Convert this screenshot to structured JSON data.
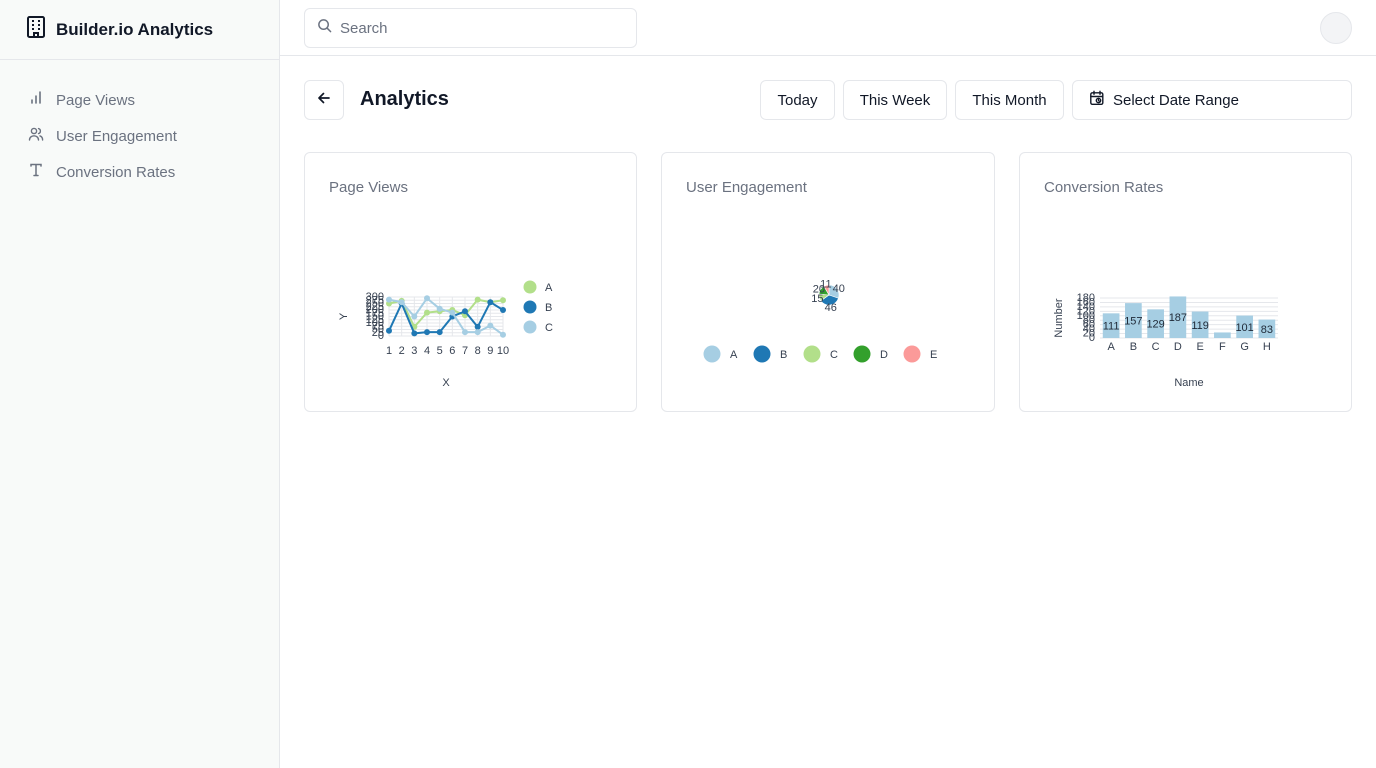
{
  "app": {
    "title": "Builder.io Analytics"
  },
  "sidebar": {
    "items": [
      {
        "label": "Page Views",
        "icon": "bar-chart-icon"
      },
      {
        "label": "User Engagement",
        "icon": "users-icon"
      },
      {
        "label": "Conversion Rates",
        "icon": "type-icon"
      }
    ]
  },
  "search": {
    "placeholder": "Search",
    "value": ""
  },
  "header": {
    "title": "Analytics",
    "buttons": {
      "today": "Today",
      "week": "This Week",
      "month": "This Month",
      "range": "Select Date Range"
    }
  },
  "cards": {
    "page_views": {
      "title": "Page Views"
    },
    "engagement": {
      "title": "User Engagement"
    },
    "conversion": {
      "title": "Conversion Rates"
    }
  },
  "colors": {
    "a_light_blue": "#a6cee3",
    "b_blue": "#1f78b4",
    "c_light_green": "#b2df8a",
    "d_green": "#33a02c",
    "e_pink": "#fb9a99"
  },
  "chart_data": [
    {
      "type": "line",
      "title": "",
      "xlabel": "X",
      "ylabel": "Y",
      "x": [
        1,
        2,
        3,
        4,
        5,
        6,
        7,
        8,
        9,
        10
      ],
      "ylim": [
        0,
        300
      ],
      "yticks": [
        0,
        25,
        50,
        75,
        100,
        125,
        150,
        175,
        200,
        225,
        250,
        275,
        300
      ],
      "legend": "right",
      "series": [
        {
          "name": "A",
          "color": "#b2df8a",
          "values": [
            250,
            270,
            70,
            180,
            190,
            200,
            160,
            280,
            260,
            275
          ]
        },
        {
          "name": "B",
          "color": "#1f78b4",
          "values": [
            40,
            250,
            20,
            30,
            30,
            150,
            190,
            70,
            260,
            200
          ]
        },
        {
          "name": "C",
          "color": "#a6cee3",
          "values": [
            280,
            260,
            150,
            290,
            210,
            180,
            30,
            30,
            80,
            10
          ]
        }
      ]
    },
    {
      "type": "pie",
      "title": "",
      "legend": "bottom",
      "slices": [
        {
          "name": "A",
          "value": 40,
          "label": "40",
          "color": "#a6cee3"
        },
        {
          "name": "B",
          "value": 46,
          "label": "46",
          "color": "#1f78b4"
        },
        {
          "name": "C",
          "value": 15,
          "label": "15",
          "color": "#b2df8a"
        },
        {
          "name": "D",
          "value": 20,
          "label": "20",
          "color": "#33a02c"
        },
        {
          "name": "E",
          "value": 11,
          "label": "11",
          "color": "#fb9a99"
        }
      ]
    },
    {
      "type": "bar",
      "title": "",
      "xlabel": "Name",
      "ylabel": "Number",
      "categories": [
        "A",
        "B",
        "C",
        "D",
        "E",
        "F",
        "G",
        "H"
      ],
      "values": [
        111,
        157,
        129,
        187,
        119,
        25,
        101,
        83
      ],
      "labels": [
        "111",
        "157",
        "129",
        "187",
        "119",
        "",
        "101",
        "83"
      ],
      "ylim": [
        0,
        180
      ],
      "yticks": [
        0,
        20,
        40,
        60,
        80,
        100,
        120,
        140,
        160,
        180
      ],
      "color": "#a6cee3"
    }
  ]
}
